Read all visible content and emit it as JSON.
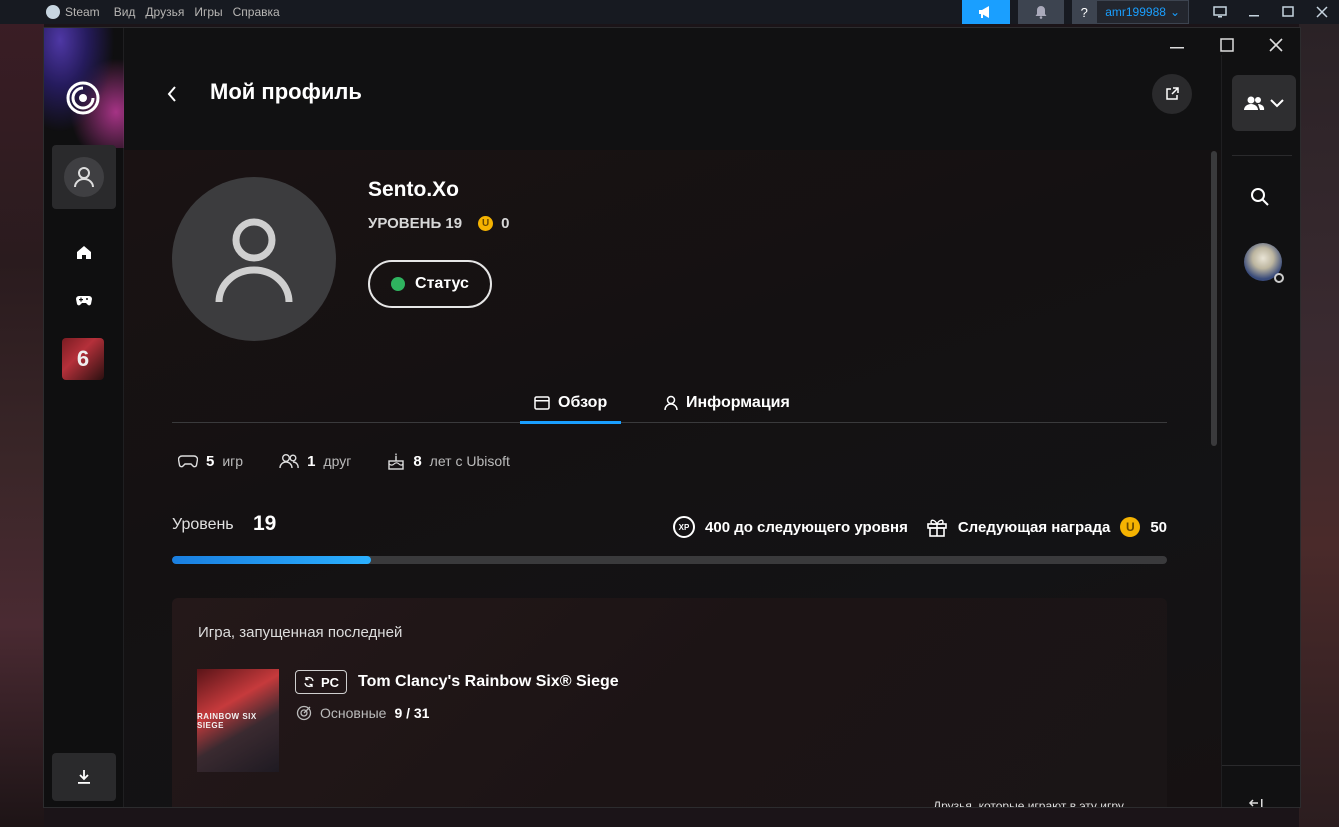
{
  "steam": {
    "app_name": "Steam",
    "menu": [
      "Вид",
      "Друзья",
      "Игры",
      "Справка"
    ],
    "help_label": "?",
    "account": "amr199988"
  },
  "header": {
    "title": "Мой профиль"
  },
  "profile": {
    "username": "Sento.Xo",
    "level_text": "УРОВЕНЬ 19",
    "coins": "0",
    "status_label": "Статус"
  },
  "tabs": [
    {
      "label": "Обзор",
      "active": true
    },
    {
      "label": "Информация",
      "active": false
    }
  ],
  "stats": {
    "games_count": "5",
    "games_label": "игр",
    "friends_count": "1",
    "friends_label": "друг",
    "years_count": "8",
    "years_label": "лет с Ubisoft"
  },
  "level": {
    "label": "Уровень",
    "value": "19",
    "xp_badge": "XP",
    "next_level_text": "400 до следующего уровня",
    "reward_label": "Следующая награда",
    "reward_coins": "50",
    "progress_percent": 20
  },
  "last_game": {
    "section_title": "Игра, запущенная последней",
    "platform": "PC",
    "name": "Tom Clancy's Rainbow Six® Siege",
    "challenges_label": "Основные",
    "challenges_value": "9 / 31",
    "cover_text": "RAINBOW SIX SIEGE"
  },
  "friends_playing": "Друзья, которые играют в эту игру",
  "colors": {
    "accent": "#1a9fff",
    "status_online": "#2fb35f",
    "coin": "#f5b301"
  }
}
